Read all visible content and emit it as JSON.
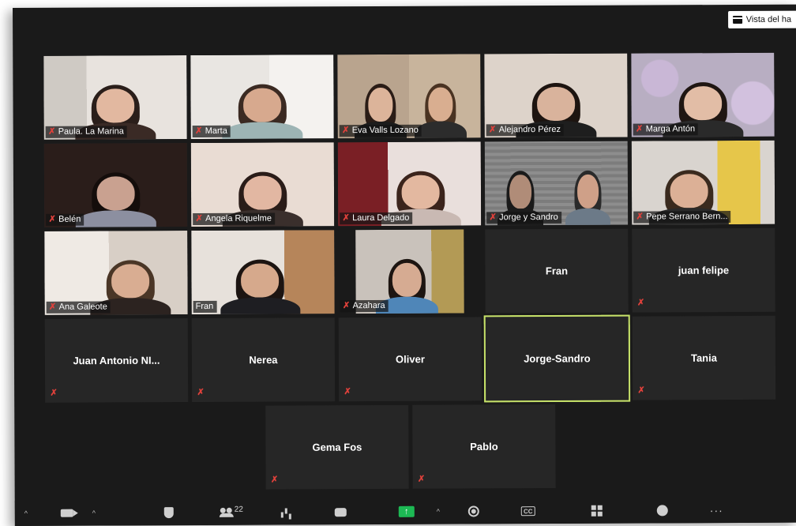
{
  "window": {
    "view_button_label": "Vista del ha"
  },
  "grid": {
    "row1": [
      {
        "name": "Paula. La Marina",
        "muted": true
      },
      {
        "name": "Marta",
        "muted": true
      },
      {
        "name": "Eva Valls Lozano",
        "muted": true
      },
      {
        "name": "Alejandro Pérez",
        "muted": true
      },
      {
        "name": "Marga Antón",
        "muted": true
      }
    ],
    "row2": [
      {
        "name": "Belén",
        "muted": true
      },
      {
        "name": "Angela Riquelme",
        "muted": true
      },
      {
        "name": "Laura Delgado",
        "muted": true
      },
      {
        "name": "Jorge y Sandro",
        "muted": true
      },
      {
        "name": "Pepe Serrano Bern...",
        "muted": true
      }
    ],
    "row3": [
      {
        "name": "Ana Galeote",
        "muted": true
      },
      {
        "name": "Fran",
        "muted": false
      },
      {
        "name": "Azahara",
        "muted": true
      },
      {
        "name": "Fran",
        "muted": false
      },
      {
        "name": "juan felipe",
        "muted": true
      }
    ],
    "row4": [
      {
        "name": "Juan Antonio NI...",
        "muted": true
      },
      {
        "name": "Nerea",
        "muted": true
      },
      {
        "name": "Oliver",
        "muted": true
      },
      {
        "name": "Jorge-Sandro",
        "muted": false,
        "active_speaker": true
      },
      {
        "name": "Tania",
        "muted": true
      }
    ],
    "row5": [
      {
        "name": "Gema Fos",
        "muted": true
      },
      {
        "name": "Pablo",
        "muted": true
      }
    ]
  },
  "toolbar": {
    "participants_count": "22",
    "mute_glyph": "✗",
    "more_glyph": "···",
    "caret_glyph": "^",
    "share_glyph": "↑",
    "cc_label": "CC"
  },
  "colors": {
    "background": "#1a1a1a",
    "tile": "#262626",
    "active_speaker_border": "#c7e26a",
    "mute_red": "#e0413b",
    "share_green": "#1db954"
  }
}
